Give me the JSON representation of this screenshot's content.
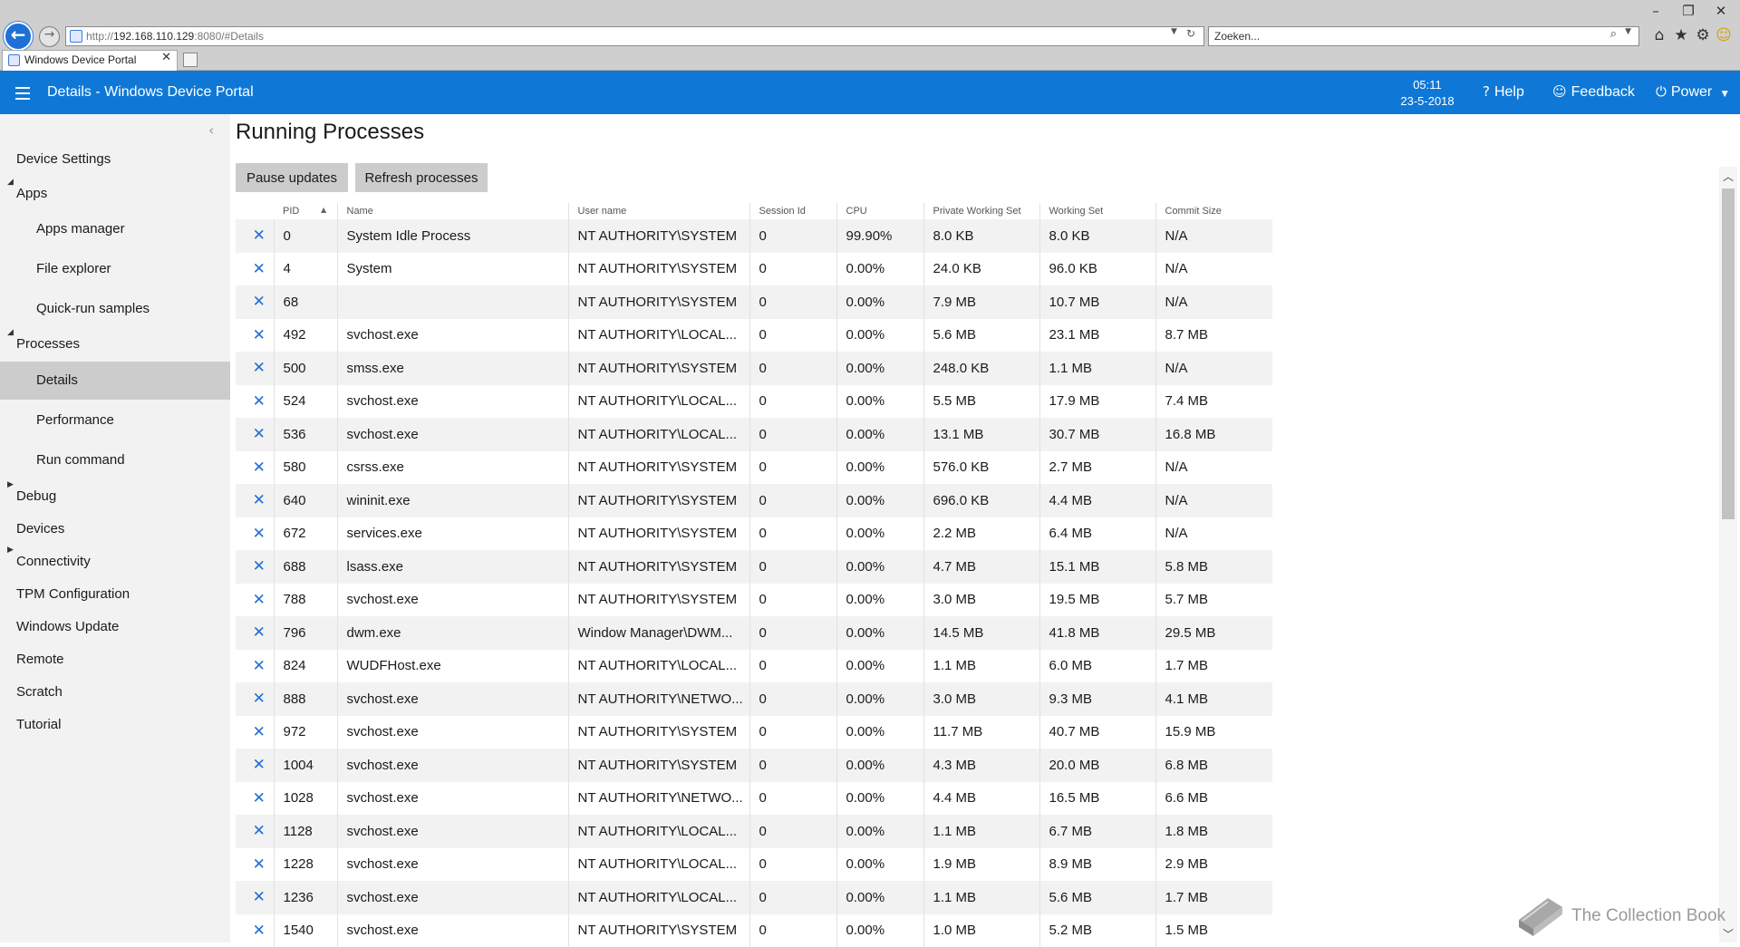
{
  "browser": {
    "url_prefix": "http://",
    "url_host": "192.168.110.129",
    "url_suffix": ":8080/#Details",
    "search_placeholder": "Zoeken...",
    "tab_title": "Windows Device Portal"
  },
  "header": {
    "title": "Details - Windows Device Portal",
    "time": "05:11",
    "date": "23-5-2018",
    "help_label": "Help",
    "feedback_label": "Feedback",
    "power_label": "Power",
    "accent_color": "#0f78d7"
  },
  "sidebar": {
    "device_settings": "Device Settings",
    "apps": "Apps",
    "apps_manager": "Apps manager",
    "file_explorer": "File explorer",
    "quick_run": "Quick-run samples",
    "processes": "Processes",
    "details": "Details",
    "performance": "Performance",
    "run_command": "Run command",
    "debug": "Debug",
    "devices": "Devices",
    "connectivity": "Connectivity",
    "tpm": "TPM Configuration",
    "windows_update": "Windows Update",
    "remote": "Remote",
    "scratch": "Scratch",
    "tutorial": "Tutorial"
  },
  "main": {
    "title": "Running Processes",
    "pause_label": "Pause updates",
    "refresh_label": "Refresh processes",
    "columns": [
      "PID",
      "Name",
      "User name",
      "Session Id",
      "CPU",
      "Private Working Set",
      "Working Set",
      "Commit Size"
    ],
    "rows": [
      [
        "0",
        "System Idle Process",
        "NT AUTHORITY\\SYSTEM",
        "0",
        "99.90%",
        "8.0 KB",
        "8.0 KB",
        "N/A"
      ],
      [
        "4",
        "System",
        "NT AUTHORITY\\SYSTEM",
        "0",
        "0.00%",
        "24.0 KB",
        "96.0 KB",
        "N/A"
      ],
      [
        "68",
        "",
        "NT AUTHORITY\\SYSTEM",
        "0",
        "0.00%",
        "7.9 MB",
        "10.7 MB",
        "N/A"
      ],
      [
        "492",
        "svchost.exe",
        "NT AUTHORITY\\LOCAL...",
        "0",
        "0.00%",
        "5.6 MB",
        "23.1 MB",
        "8.7 MB"
      ],
      [
        "500",
        "smss.exe",
        "NT AUTHORITY\\SYSTEM",
        "0",
        "0.00%",
        "248.0 KB",
        "1.1 MB",
        "N/A"
      ],
      [
        "524",
        "svchost.exe",
        "NT AUTHORITY\\LOCAL...",
        "0",
        "0.00%",
        "5.5 MB",
        "17.9 MB",
        "7.4 MB"
      ],
      [
        "536",
        "svchost.exe",
        "NT AUTHORITY\\LOCAL...",
        "0",
        "0.00%",
        "13.1 MB",
        "30.7 MB",
        "16.8 MB"
      ],
      [
        "580",
        "csrss.exe",
        "NT AUTHORITY\\SYSTEM",
        "0",
        "0.00%",
        "576.0 KB",
        "2.7 MB",
        "N/A"
      ],
      [
        "640",
        "wininit.exe",
        "NT AUTHORITY\\SYSTEM",
        "0",
        "0.00%",
        "696.0 KB",
        "4.4 MB",
        "N/A"
      ],
      [
        "672",
        "services.exe",
        "NT AUTHORITY\\SYSTEM",
        "0",
        "0.00%",
        "2.2 MB",
        "6.4 MB",
        "N/A"
      ],
      [
        "688",
        "lsass.exe",
        "NT AUTHORITY\\SYSTEM",
        "0",
        "0.00%",
        "4.7 MB",
        "15.1 MB",
        "5.8 MB"
      ],
      [
        "788",
        "svchost.exe",
        "NT AUTHORITY\\SYSTEM",
        "0",
        "0.00%",
        "3.0 MB",
        "19.5 MB",
        "5.7 MB"
      ],
      [
        "796",
        "dwm.exe",
        "Window Manager\\DWM...",
        "0",
        "0.00%",
        "14.5 MB",
        "41.8 MB",
        "29.5 MB"
      ],
      [
        "824",
        "WUDFHost.exe",
        "NT AUTHORITY\\LOCAL...",
        "0",
        "0.00%",
        "1.1 MB",
        "6.0 MB",
        "1.7 MB"
      ],
      [
        "888",
        "svchost.exe",
        "NT AUTHORITY\\NETWO...",
        "0",
        "0.00%",
        "3.0 MB",
        "9.3 MB",
        "4.1 MB"
      ],
      [
        "972",
        "svchost.exe",
        "NT AUTHORITY\\SYSTEM",
        "0",
        "0.00%",
        "11.7 MB",
        "40.7 MB",
        "15.9 MB"
      ],
      [
        "1004",
        "svchost.exe",
        "NT AUTHORITY\\SYSTEM",
        "0",
        "0.00%",
        "4.3 MB",
        "20.0 MB",
        "6.8 MB"
      ],
      [
        "1028",
        "svchost.exe",
        "NT AUTHORITY\\NETWO...",
        "0",
        "0.00%",
        "4.4 MB",
        "16.5 MB",
        "6.6 MB"
      ],
      [
        "1128",
        "svchost.exe",
        "NT AUTHORITY\\LOCAL...",
        "0",
        "0.00%",
        "1.1 MB",
        "6.7 MB",
        "1.8 MB"
      ],
      [
        "1228",
        "svchost.exe",
        "NT AUTHORITY\\LOCAL...",
        "0",
        "0.00%",
        "1.9 MB",
        "8.9 MB",
        "2.9 MB"
      ],
      [
        "1236",
        "svchost.exe",
        "NT AUTHORITY\\LOCAL...",
        "0",
        "0.00%",
        "1.1 MB",
        "5.6 MB",
        "1.7 MB"
      ],
      [
        "1540",
        "svchost.exe",
        "NT AUTHORITY\\SYSTEM",
        "0",
        "0.00%",
        "1.0 MB",
        "5.2 MB",
        "1.5 MB"
      ]
    ]
  },
  "watermark": {
    "text": "The Collection Book"
  }
}
